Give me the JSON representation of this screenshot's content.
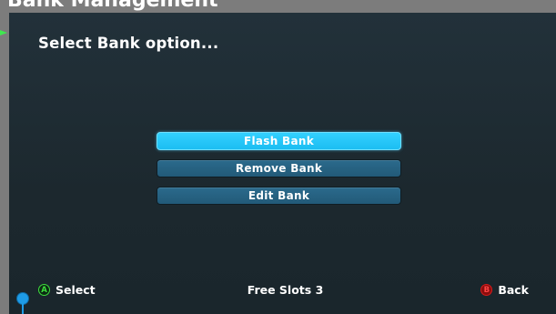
{
  "window": {
    "title": "Bank Management"
  },
  "screen": {
    "heading": "Select Bank option..."
  },
  "menu": {
    "items": [
      {
        "label": "Flash Bank",
        "selected": true
      },
      {
        "label": "Remove Bank",
        "selected": false
      },
      {
        "label": "Edit Bank",
        "selected": false
      }
    ]
  },
  "footer": {
    "select_button_glyph": "A",
    "select_label": "Select",
    "free_slots": "Free Slots 3",
    "back_button_glyph": "B",
    "back_label": "Back"
  },
  "colors": {
    "selected_item": "#1cbdf2",
    "item": "#225a78",
    "background": "#1d2a30",
    "a_button": "#3ddc3d",
    "b_button": "#d81a1a",
    "pointer": "#1e9be6"
  },
  "icons": {
    "a_button": "a-button-icon",
    "b_button": "b-button-icon",
    "edge_marker": "green-arrow-marker-icon",
    "pointer": "location-pin-icon"
  }
}
